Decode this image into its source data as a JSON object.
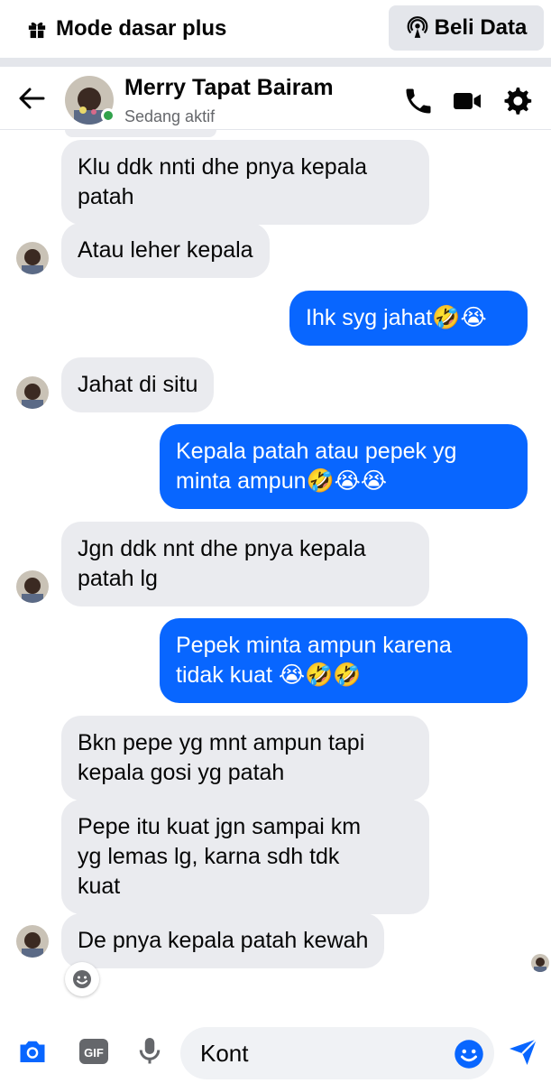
{
  "banner": {
    "title": "Mode dasar plus",
    "data_button": "Beli Data"
  },
  "header": {
    "name": "Merry Tapat Bairam",
    "status": "Sedang aktif"
  },
  "messages": [
    {
      "text": "Klu ddk nnti dhe pnya kepala\npatah"
    },
    {
      "text": "Atau leher kepala"
    },
    {
      "text": "Ihk syg jahat🤣😭"
    },
    {
      "text": "Jahat di situ"
    },
    {
      "text": "Kepala patah atau pepek yg\nminta ampun🤣😭😭"
    },
    {
      "text": "Jgn ddk nnt dhe pnya kepala\npatah lg"
    },
    {
      "text": "Pepek minta ampun karena\ntidak kuat 😭🤣🤣"
    },
    {
      "text": "Bkn pepe yg mnt ampun tapi\nkepala gosi yg patah"
    },
    {
      "text": "Pepe itu kuat jgn sampai km\nyg lemas lg, karna sdh tdk\nkuat"
    },
    {
      "text": "De pnya kepala patah kewah"
    }
  ],
  "composer": {
    "value": "Kont"
  },
  "colors": {
    "accent": "#0866ff",
    "incoming": "#eaebef",
    "online": "#31a24c"
  },
  "icons": [
    "gift-icon",
    "broadcast-icon",
    "back-arrow-icon",
    "phone-icon",
    "video-icon",
    "gear-icon",
    "camera-icon",
    "gif-icon",
    "microphone-icon",
    "smiley-icon",
    "send-icon"
  ]
}
